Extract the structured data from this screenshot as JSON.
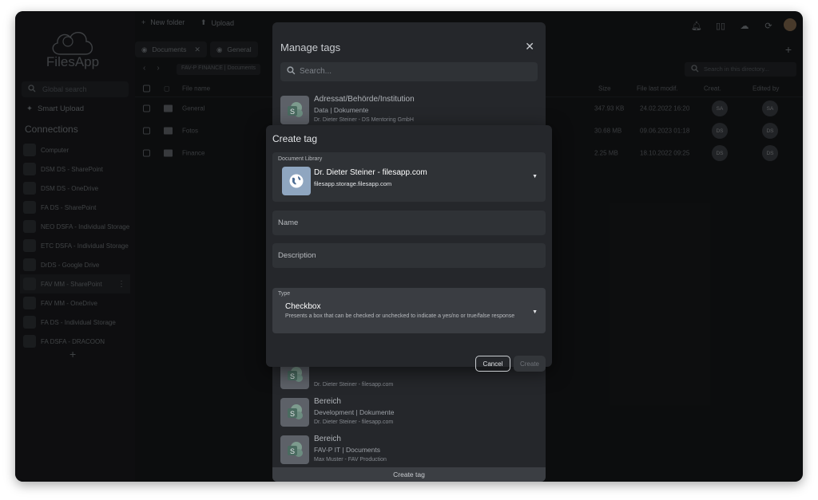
{
  "app": {
    "name": "FilesApp",
    "search_placeholder": "Global search",
    "smart_upload": "Smart Upload",
    "connections_title": "Connections",
    "connections": [
      {
        "label": "Computer"
      },
      {
        "label": "DSM DS - SharePoint"
      },
      {
        "label": "DSM DS - OneDrive"
      },
      {
        "label": "FA DS - SharePoint"
      },
      {
        "label": "NEO DSFA - Individual Storage"
      },
      {
        "label": "ETC DSFA - Individual Storage"
      },
      {
        "label": "DrDS - Google Drive"
      },
      {
        "label": "FAV MM - SharePoint",
        "active": true
      },
      {
        "label": "FAV MM - OneDrive"
      },
      {
        "label": "FA DS - Individual Storage"
      },
      {
        "label": "FA DSFA - DRACOON"
      }
    ],
    "add_connection": "+"
  },
  "toolbar": {
    "new_folder": "New folder",
    "upload": "Upload"
  },
  "tabs": [
    {
      "label": "Documents"
    },
    {
      "label": "General"
    }
  ],
  "path": {
    "crumb": "FAV-P FINANCE | Documents",
    "search_placeholder": "Search in this directory..."
  },
  "table": {
    "headers": {
      "name": "File name",
      "size": "Size",
      "modified": "File last modif.",
      "created": "Creat.",
      "edited": "Edited by"
    },
    "rows": [
      {
        "name": "General",
        "size": "347.93 KB",
        "modified": "24.02.2022 16:20",
        "created": "SA",
        "edited": "SA"
      },
      {
        "name": "Fotos",
        "size": "30.68 MB",
        "modified": "09.06.2023 01:18",
        "created": "DS",
        "edited": "DS"
      },
      {
        "name": "Finance",
        "size": "2.25 MB",
        "modified": "18.10.2022 09:25",
        "created": "DS",
        "edited": "DS"
      }
    ]
  },
  "manage_tags": {
    "title": "Manage tags",
    "search_placeholder": "Search...",
    "items": [
      {
        "name": "Adressat/Behörde/Institution",
        "sub": "Data | Dokumente",
        "owner": "Dr. Dieter Steiner - DS Mentoring GmbH"
      },
      {
        "name": "",
        "sub": "",
        "owner": "Dr. Dieter Steiner - filesapp.com"
      },
      {
        "name": "Bereich",
        "sub": "Development | Dokumente",
        "owner": "Dr. Dieter Steiner - filesapp.com"
      },
      {
        "name": "Bereich",
        "sub": "FAV-P IT | Documents",
        "owner": "Max Muster - FAV Production"
      }
    ],
    "create_button": "Create tag"
  },
  "create_tag": {
    "title": "Create tag",
    "library_label": "Document Library",
    "library_name": "Dr. Dieter Steiner - filesapp.com",
    "library_host": "filesapp.storage.filesapp.com",
    "name_placeholder": "Name",
    "description_placeholder": "Description",
    "type_label": "Type",
    "type_value": "Checkbox",
    "type_desc": "Presents a box that can be checked or unchecked to indicate a yes/no or true/false response",
    "cancel": "Cancel",
    "create": "Create"
  }
}
